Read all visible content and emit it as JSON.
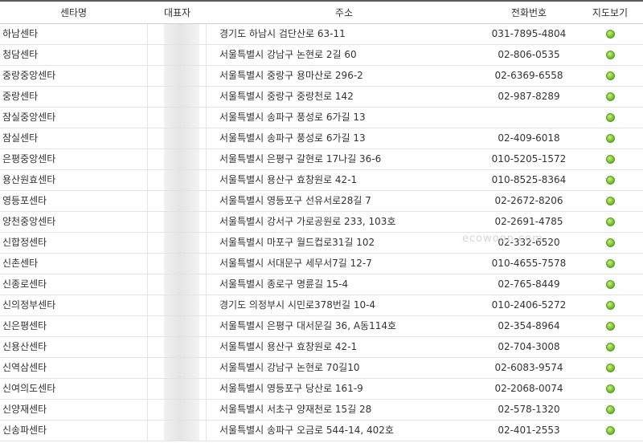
{
  "watermark": "ecowoon.com",
  "headers": {
    "name": "센타명",
    "rep": "대표자",
    "address": "주소",
    "phone": "전화번호",
    "map": "지도보기"
  },
  "rows": [
    {
      "name": "하남센타",
      "address": "경기도 하남시 검단산로 63-11",
      "phone": "031-7895-4804"
    },
    {
      "name": "청담센타",
      "address": "서울특별시 강남구 논현로 2길 60",
      "phone": "02-806-0535"
    },
    {
      "name": "중랑중앙센타",
      "address": "서울특별시 중랑구 용마산로 296-2",
      "phone": "02-6369-6558"
    },
    {
      "name": "중랑센타",
      "address": "서울특별시 중랑구 중랑천로 142",
      "phone": "02-987-8289"
    },
    {
      "name": "잠실중앙센타",
      "address": "서울특별시 송파구 풍성로 6가길 13",
      "phone": ""
    },
    {
      "name": "잠실센타",
      "address": "서울특별시 송파구 풍성로 6가길 13",
      "phone": "02-409-6018"
    },
    {
      "name": "은평중앙센타",
      "address": "서울특별시 은평구 갈현로 17나길 36-6",
      "phone": "010-5205-1572"
    },
    {
      "name": "용산원효센타",
      "address": "서울특별시 용산구 효창원로 42-1",
      "phone": "010-8525-8364"
    },
    {
      "name": "영등포센타",
      "address": "서울특별시 영등포구 선유서로28길 7",
      "phone": "02-2672-8206"
    },
    {
      "name": "양천중앙센타",
      "address": "서울특별시 강서구 가로공원로 233, 103호",
      "phone": "02-2691-4785"
    },
    {
      "name": "신합정센타",
      "address": "서울특별시 마포구 월드컵로31길 102",
      "phone": "02-332-6520"
    },
    {
      "name": "신촌센타",
      "address": "서울특별시 서대문구 세무서7길 12-7",
      "phone": "010-4655-7578"
    },
    {
      "name": "신종로센타",
      "address": "서울특별시 종로구 명륜길 15-4",
      "phone": "02-765-8449"
    },
    {
      "name": "신의정부센타",
      "address": "경기도 의정부시 시민로378번길 10-4",
      "phone": "010-2406-5272"
    },
    {
      "name": "신은평센타",
      "address": "서울특별시 은평구 대서문길 36, A동114호",
      "phone": "02-354-8964"
    },
    {
      "name": "신용산센타",
      "address": "서울특별시 용산구 효창원로 42-1",
      "phone": "02-704-3008"
    },
    {
      "name": "신역삼센타",
      "address": "서울특별시 강남구 논현로 70길10",
      "phone": "02-6083-9574"
    },
    {
      "name": "신여의도센타",
      "address": "서울특별시 영등포구 당산로 161-9",
      "phone": "02-2068-0074"
    },
    {
      "name": "신양재센타",
      "address": "서울특별시 서초구 양재천로 15길 28",
      "phone": "02-578-1320"
    },
    {
      "name": "신송파센타",
      "address": "서울특별시 송파구 오금로 544-14, 402호",
      "phone": "02-401-2553"
    }
  ],
  "icons": {
    "map": "map-marker-green-icon"
  },
  "colors": {
    "header_border": "#5d5d5d",
    "row_border": "#e3e3e3",
    "text": "#333333",
    "map_icon": "#7cc334"
  }
}
